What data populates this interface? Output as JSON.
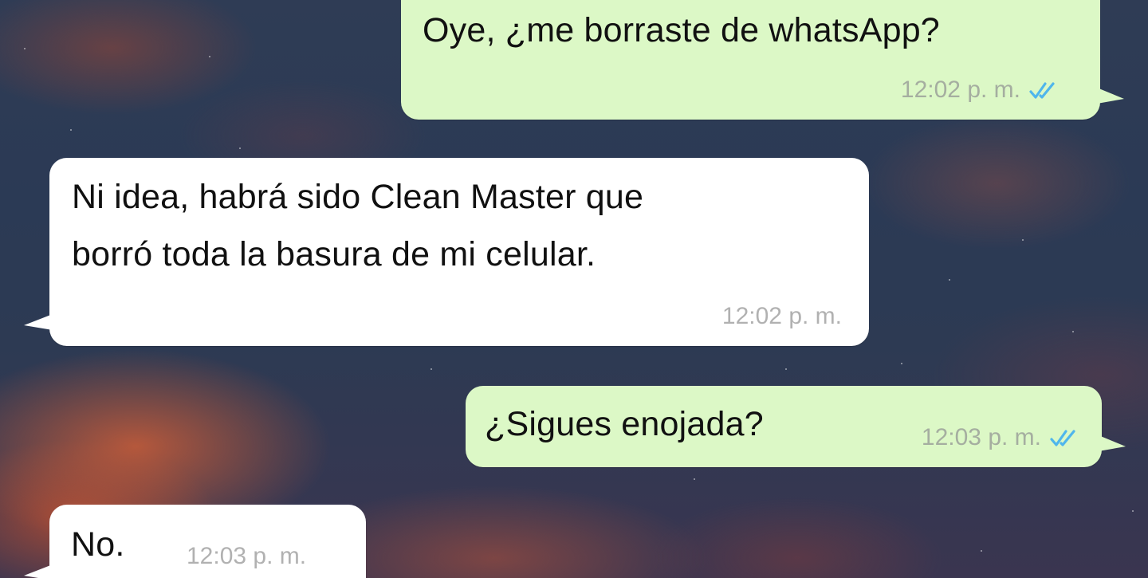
{
  "chat": {
    "messages": [
      {
        "direction": "outgoing",
        "text": "Oye, ¿me borraste de whatsApp?",
        "time": "12:02 p. m.",
        "status": "read-double-check-icon"
      },
      {
        "direction": "incoming",
        "lines": [
          "Ni idea, habrá sido Clean Master que",
          "borró toda la basura de mi celular."
        ],
        "time": "12:02 p. m."
      },
      {
        "direction": "outgoing",
        "text": "¿Sigues enojada?",
        "time": "12:03 p. m.",
        "status": "read-double-check-icon"
      },
      {
        "direction": "incoming",
        "text": "No.",
        "time": "12:03 p. m."
      }
    ]
  },
  "colors": {
    "outgoing_bubble": "#dcf8c6",
    "incoming_bubble": "#ffffff",
    "read_ticks": "#4fb6ec",
    "timestamp": "#a5aea0"
  }
}
